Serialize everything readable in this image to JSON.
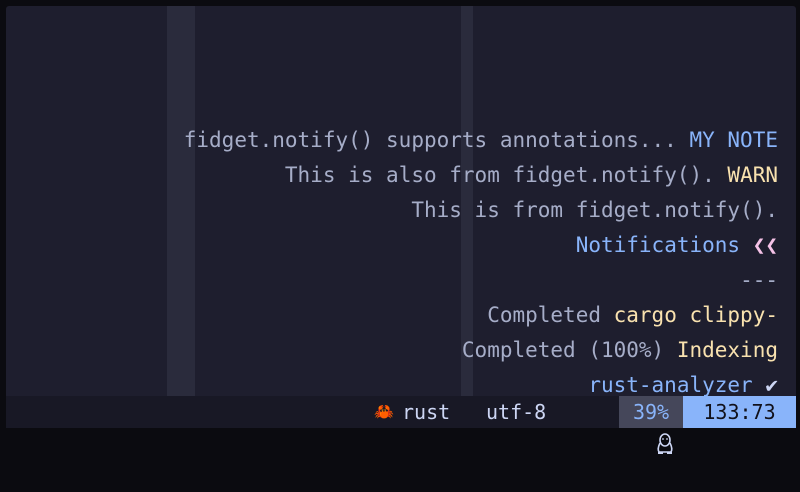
{
  "notifications": {
    "lines": [
      {
        "message": "fidget.notify() supports annotations... ",
        "annote": "MY NOTE"
      },
      {
        "message": "This is also from fidget.notify(). ",
        "annote": "WARN"
      },
      {
        "message": "This is from fidget.notify().",
        "annote": ""
      },
      {
        "message": "Notifications ",
        "annote": "❮❮"
      },
      {
        "message": "---",
        "annote": ""
      },
      {
        "message": "Completed ",
        "annote": "cargo clippy-"
      },
      {
        "message": "Completed (100%) ",
        "annote": "Indexing"
      },
      {
        "message": "rust-analyzer ",
        "annote": "✔"
      }
    ]
  },
  "statusbar": {
    "language_icon": "rust-crab-icon",
    "language_glyph": "🦀",
    "language": "rust",
    "encoding": "utf-8",
    "os_icon": "linux-tux-icon",
    "percent": "39%",
    "position": "133:73"
  },
  "colors": {
    "editor_bg": "#1e1e2e",
    "accent_blue": "#89b4fa",
    "accent_yellow": "#f9e2af",
    "text": "#cdd6f4",
    "subtext": "#a6adc8"
  }
}
